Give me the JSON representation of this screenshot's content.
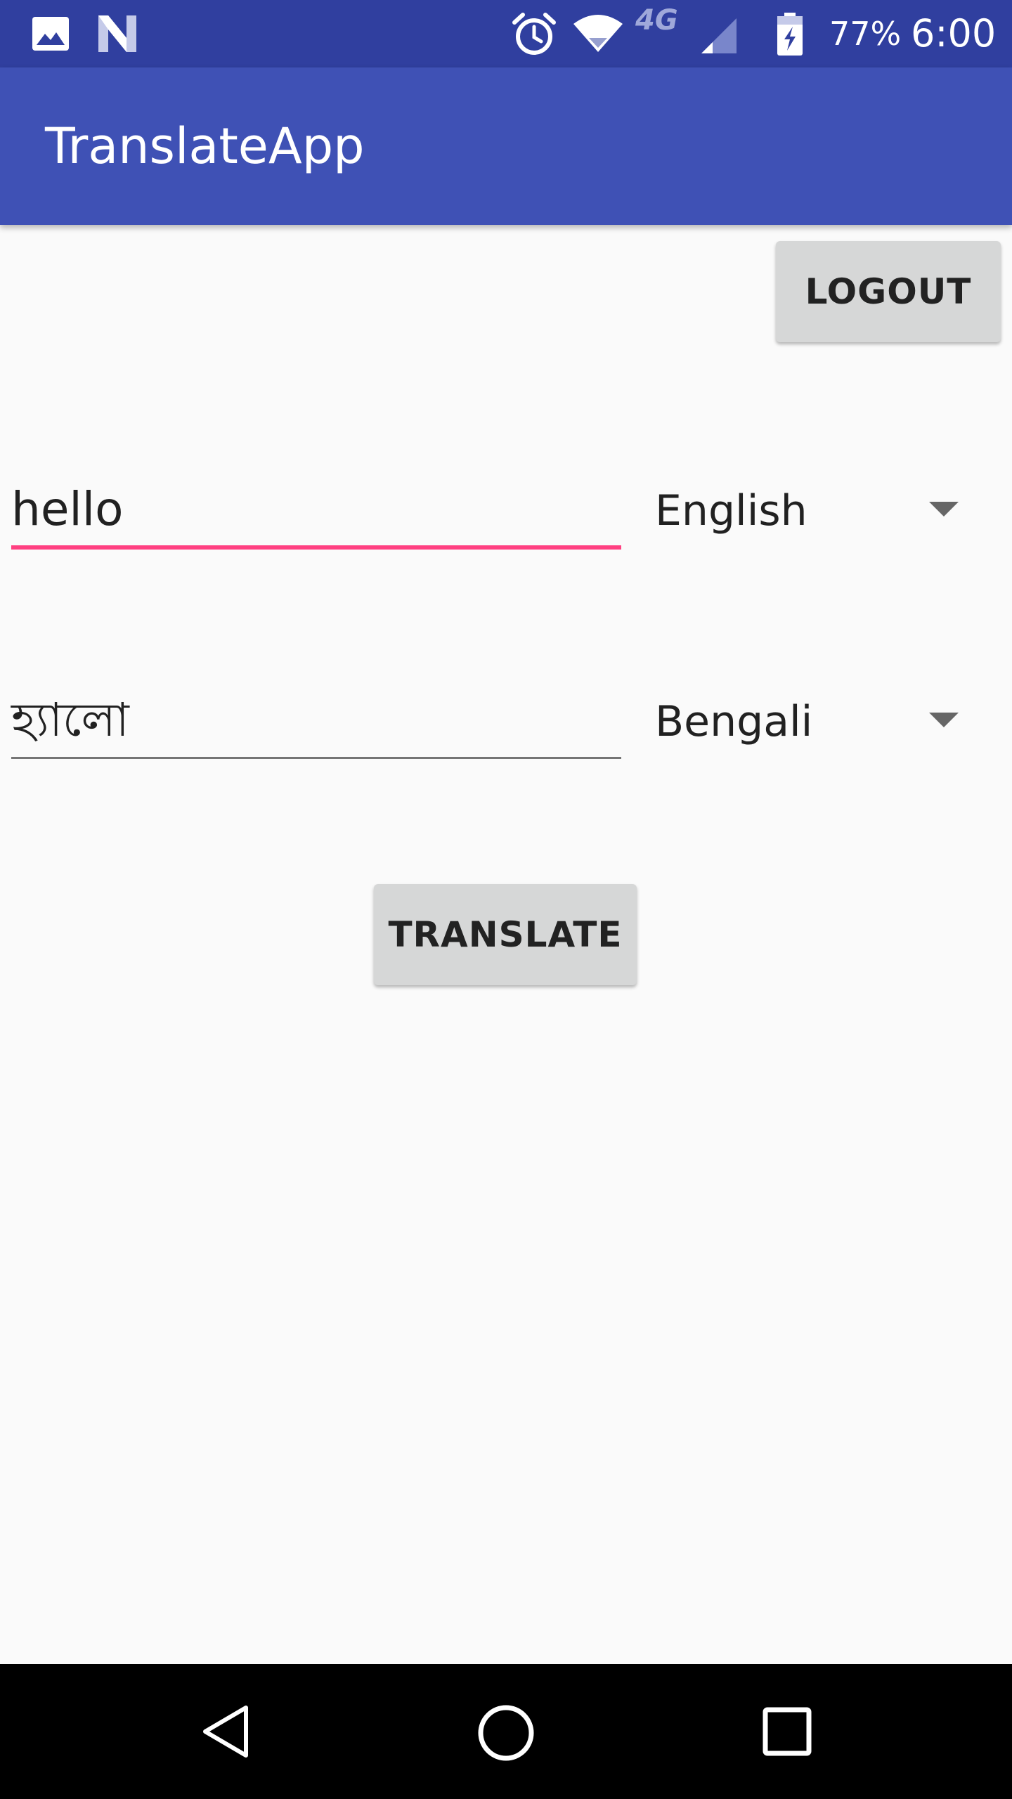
{
  "status_bar": {
    "battery": "77%",
    "time": "6:00",
    "network": "4G",
    "icons": [
      "image-icon",
      "n-icon",
      "alarm-icon",
      "wifi-icon",
      "signal-icon",
      "battery-charging-icon"
    ]
  },
  "app_bar": {
    "title": "TranslateApp"
  },
  "logout_button": {
    "label": "LOGOUT"
  },
  "source": {
    "text": "hello",
    "language": "English"
  },
  "target": {
    "text": "হ্যালো",
    "language": "Bengali"
  },
  "translate_button": {
    "label": "TRANSLATE"
  },
  "nav_bar": {
    "icons": [
      "back-icon",
      "home-icon",
      "recents-icon"
    ]
  },
  "colors": {
    "status_bar": "#303f9f",
    "app_bar": "#3f51b5",
    "accent": "#ff4081",
    "background": "#fafafa",
    "button": "#d6d7d7"
  }
}
